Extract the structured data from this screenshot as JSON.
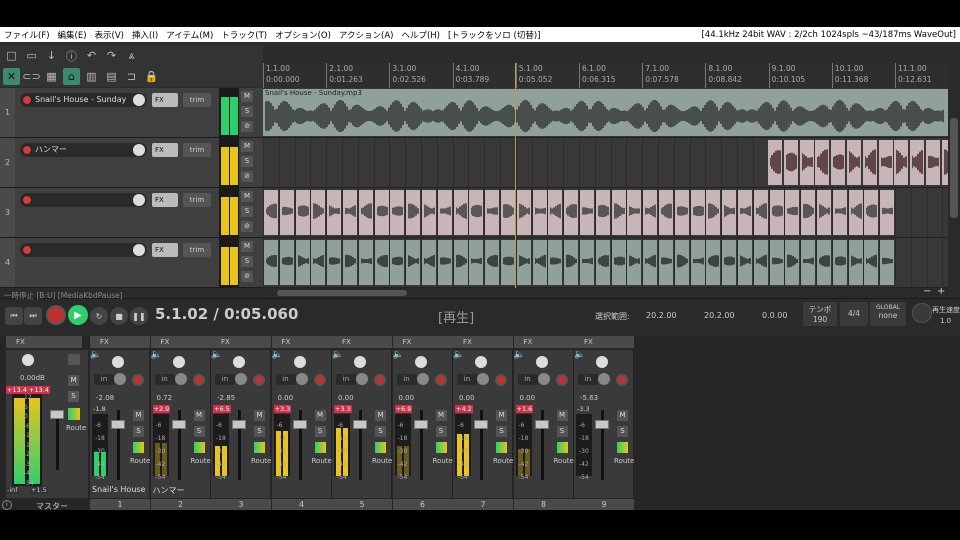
{
  "menu": {
    "items": [
      "ファイル(F)",
      "編集(E)",
      "表示(V)",
      "挿入(I)",
      "アイテム(M)",
      "トラック(T)",
      "オプション(O)",
      "アクション(A)",
      "ヘルプ(H)",
      "[トラックをソロ (切替)]"
    ],
    "status": "[44.1kHz 24bit WAV : 2/2ch 1024spls ~43/187ms WaveOut]"
  },
  "ruler": {
    "bars": [
      "1.1.00",
      "2.1.00",
      "3.1.00",
      "4.1.00",
      "5.1.00",
      "6.1.00",
      "7.1.00",
      "8.1.00",
      "9.1.00",
      "10.1.00",
      "11.1.00"
    ],
    "times": [
      "0:00.000",
      "0:01.263",
      "0:02.526",
      "0:03.789",
      "0:05.052",
      "0:06.315",
      "0:07.578",
      "0:08.842",
      "0:10.105",
      "0:11.368",
      "0:12.631"
    ]
  },
  "tracks": [
    {
      "num": "1",
      "name": "Snail's House - Sunday",
      "fx": "FX",
      "trim": "trim",
      "m": "M",
      "s": "S"
    },
    {
      "num": "2",
      "name": "ハンマー",
      "fx": "FX",
      "trim": "trim",
      "m": "M",
      "s": "S"
    },
    {
      "num": "3",
      "name": "",
      "fx": "FX",
      "trim": "trim",
      "m": "M",
      "s": "S"
    },
    {
      "num": "4",
      "name": "",
      "fx": "FX",
      "trim": "trim",
      "m": "M",
      "s": "S"
    }
  ],
  "item1_name": "Snail's House - Sunday.mp3",
  "colors": {
    "wave_item": "#8fa19a",
    "red_item": "#c8b5b7",
    "meter_green": "#2ecf6a",
    "meter_yellow": "#e8c41c",
    "accent": "#3a8a6c"
  },
  "transport": {
    "play_state": "一時停止 [B:U] [MediaKbdPause]",
    "time": "5.1.02 / 0:05.060",
    "status": "[再生]",
    "selection_label": "選択範囲:",
    "sel_start": "20.2.00",
    "sel_end": "20.2.00",
    "sel_len": "0.0.00",
    "tempo_label": "テンポ",
    "tempo": "190",
    "timesig": "4/4",
    "global_label": "GLOBAL",
    "global_val": "none",
    "rate_label": "再生速度",
    "rate": "1.0"
  },
  "master": {
    "label": "マスター",
    "db": "0.00dB",
    "peak_l": "+13.4",
    "peak_r": "+13.4",
    "route": "Route",
    "mono": "M",
    "solo": "S",
    "scale": [
      "12",
      "6",
      "0",
      "-6",
      "-12",
      "-18",
      "-24",
      "-30",
      "-42",
      "-54"
    ],
    "bottom_l": "-inf",
    "bottom_r": "+1.5"
  },
  "strips": [
    {
      "num": "1",
      "db": "-2.08",
      "peak": "-1.8",
      "name": "Snail's House",
      "fx": "FX",
      "in": "in",
      "route": "Route"
    },
    {
      "num": "2",
      "db": "0.72",
      "peak": "+2.9",
      "name": "ハンマー",
      "fx": "FX",
      "in": "in",
      "route": "Route"
    },
    {
      "num": "3",
      "db": "-2.85",
      "peak": "+6.5",
      "name": "",
      "fx": "FX",
      "in": "in",
      "route": "Route"
    },
    {
      "num": "4",
      "db": "0.00",
      "peak": "+3.3",
      "name": "",
      "fx": "FX",
      "in": "in",
      "route": "Route"
    },
    {
      "num": "5",
      "db": "0.00",
      "peak": "+3.3",
      "name": "",
      "fx": "FX",
      "in": "in",
      "route": "Route"
    },
    {
      "num": "6",
      "db": "0.00",
      "peak": "+6.9",
      "name": "",
      "fx": "FX",
      "in": "in",
      "route": "Route"
    },
    {
      "num": "7",
      "db": "0.00",
      "peak": "+4.2",
      "name": "",
      "fx": "FX",
      "in": "in",
      "route": "Route"
    },
    {
      "num": "8",
      "db": "0.00",
      "peak": "+1.6",
      "name": "",
      "fx": "FX",
      "in": "in",
      "route": "Route"
    },
    {
      "num": "9",
      "db": "-5.63",
      "peak": "-3.3",
      "name": "",
      "fx": "FX",
      "in": "in",
      "route": "Route"
    }
  ],
  "strip_scale": [
    "-6",
    "-18",
    "-30",
    "-42",
    "-54"
  ],
  "strip_levels": [
    0.4,
    0.55,
    0.5,
    0.75,
    0.8,
    0.5,
    0.7,
    0.45,
    0
  ],
  "strip_meter_colors": [
    "#2ecf6a",
    "#6a5a20",
    "#e8c41c",
    "#e8c41c",
    "#e8c41c",
    "#6a5a20",
    "#e8c41c",
    "#6a5a20",
    "#2a2a2a"
  ]
}
